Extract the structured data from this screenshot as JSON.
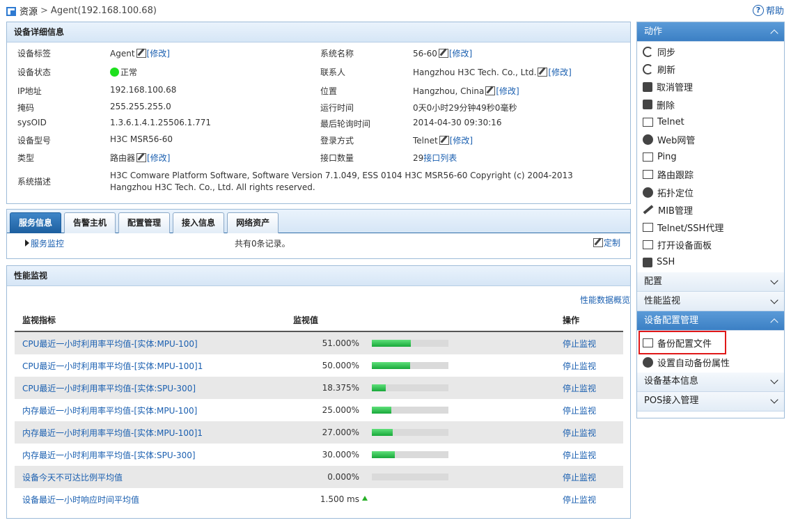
{
  "breadcrumb": {
    "root": "资源",
    "sep": ">",
    "current": "Agent(192.168.100.68)"
  },
  "help_label": "帮助",
  "device": {
    "title": "设备详细信息",
    "edit_label": "[修改]",
    "left": [
      {
        "label": "设备标签",
        "value": "Agent",
        "editable": true
      },
      {
        "label": "设备状态",
        "value": "正常",
        "status": true
      },
      {
        "label": "IP地址",
        "value": "192.168.100.68"
      },
      {
        "label": "掩码",
        "value": "255.255.255.0"
      },
      {
        "label": "sysOID",
        "value": "1.3.6.1.4.1.25506.1.771"
      },
      {
        "label": "设备型号",
        "value": "H3C MSR56-60"
      },
      {
        "label": "类型",
        "value": "路由器",
        "editable": true
      }
    ],
    "right": [
      {
        "label": "系统名称",
        "value": "56-60",
        "editable": true
      },
      {
        "label": "联系人",
        "value": "Hangzhou H3C Tech. Co., Ltd.",
        "editable": true
      },
      {
        "label": "位置",
        "value": "Hangzhou, China",
        "editable": true
      },
      {
        "label": "运行时间",
        "value": "0天0小时29分钟49秒0毫秒"
      },
      {
        "label": "最后轮询时间",
        "value": "2014-04-30 09:30:16"
      },
      {
        "label": "登录方式",
        "value": "Telnet",
        "editable": true
      },
      {
        "label": "接口数量",
        "value": "29",
        "link": "接口列表"
      }
    ],
    "desc_label": "系统描述",
    "desc_value": "H3C Comware Platform Software, Software Version 7.1.049, ESS 0104 H3C MSR56-60 Copyright (c) 2004-2013 Hangzhou H3C Tech. Co., Ltd. All rights reserved."
  },
  "tabs": [
    "服务信息",
    "告警主机",
    "配置管理",
    "接入信息",
    "网络资产"
  ],
  "service": {
    "link": "服务监控",
    "count": "共有0条记录。",
    "custom": "定制"
  },
  "perf": {
    "title": "性能监视",
    "overview": "性能数据概览",
    "headers": {
      "metric": "监视指标",
      "value": "监视值",
      "op": "操作"
    },
    "rows": [
      {
        "metric": "CPU最近一小时利用率平均值-[实体:MPU-100]",
        "value": "51.000%",
        "pct": 0.51,
        "op": "停止监视"
      },
      {
        "metric": "CPU最近一小时利用率平均值-[实体:MPU-100]1",
        "value": "50.000%",
        "pct": 0.5,
        "op": "停止监视"
      },
      {
        "metric": "CPU最近一小时利用率平均值-[实体:SPU-300]",
        "value": "18.375%",
        "pct": 0.18375,
        "op": "停止监视"
      },
      {
        "metric": "内存最近一小时利用率平均值-[实体:MPU-100]",
        "value": "25.000%",
        "pct": 0.25,
        "op": "停止监视"
      },
      {
        "metric": "内存最近一小时利用率平均值-[实体:MPU-100]1",
        "value": "27.000%",
        "pct": 0.27,
        "op": "停止监视"
      },
      {
        "metric": "内存最近一小时利用率平均值-[实体:SPU-300]",
        "value": "30.000%",
        "pct": 0.3,
        "op": "停止监视"
      },
      {
        "metric": "设备今天不可达比例平均值",
        "value": "0.000%",
        "pct": 0.0,
        "op": "停止监视"
      },
      {
        "metric": "设备最近一小时响应时间平均值",
        "value": "1.500 ms",
        "arrow": true,
        "op": "停止监视"
      }
    ]
  },
  "side": {
    "actions_title": "动作",
    "actions": [
      {
        "label": "同步",
        "icon": "sync-icon"
      },
      {
        "label": "刷新",
        "icon": "refresh-icon"
      },
      {
        "label": "取消管理",
        "icon": "unmanage-icon"
      },
      {
        "label": "删除",
        "icon": "trash-icon"
      },
      {
        "label": "Telnet",
        "icon": "telnet-icon"
      },
      {
        "label": "Web网管",
        "icon": "web-manage-icon"
      },
      {
        "label": "Ping",
        "icon": "ping-icon"
      },
      {
        "label": "路由跟踪",
        "icon": "traceroute-icon"
      },
      {
        "label": "拓扑定位",
        "icon": "topology-icon"
      },
      {
        "label": "MIB管理",
        "icon": "wrench-icon"
      },
      {
        "label": "Telnet/SSH代理",
        "icon": "proxy-icon"
      },
      {
        "label": "打开设备面板",
        "icon": "panel-icon"
      },
      {
        "label": "SSH",
        "icon": "ssh-icon"
      }
    ],
    "config_title": "配置",
    "perf_title": "性能监视",
    "devcfg_title": "设备配置管理",
    "devcfg_items": [
      {
        "label": "备份配置文件",
        "icon": "backup-icon"
      },
      {
        "label": "设置自动备份属性",
        "icon": "gears-icon"
      }
    ],
    "basic_title": "设备基本信息",
    "pos_title": "POS接入管理"
  }
}
